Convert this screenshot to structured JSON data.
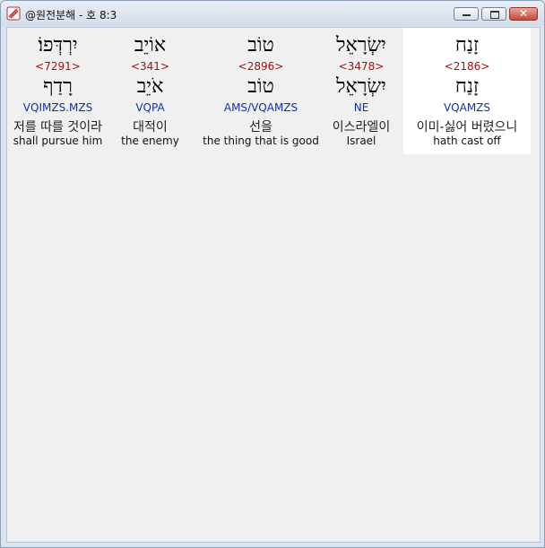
{
  "window": {
    "title": "@원전분해 - 호 8:3"
  },
  "words": [
    {
      "hebrew": "יִרְדְּפוֹ׃",
      "strong": "<7291>",
      "lemma": "רָדַף",
      "parse": "VQIMZS.MZS",
      "korean": "저를 따를 것이라",
      "english": "shall pursue him"
    },
    {
      "hebrew": "אוֹיֵב",
      "strong": "<341>",
      "lemma": "אֹיֵב",
      "parse": "VQPA",
      "korean": "대적이",
      "english": "the enemy"
    },
    {
      "hebrew": "טוֹב",
      "strong": "<2896>",
      "lemma": "טוֹב",
      "parse": "AMS/VQAMZS",
      "korean": "선을",
      "english": "the thing that is good"
    },
    {
      "hebrew": "יִשְׂרָאֵל",
      "strong": "<3478>",
      "lemma": "יִשְׂרָאֵל",
      "parse": "NE",
      "korean": "이스라엘이",
      "english": "Israel"
    },
    {
      "hebrew": "זָנַח",
      "strong": "<2186>",
      "lemma": "זָנַח",
      "parse": "VQAMZS",
      "korean": "이미-싫어 버렸으니",
      "english": "hath cast off"
    }
  ]
}
